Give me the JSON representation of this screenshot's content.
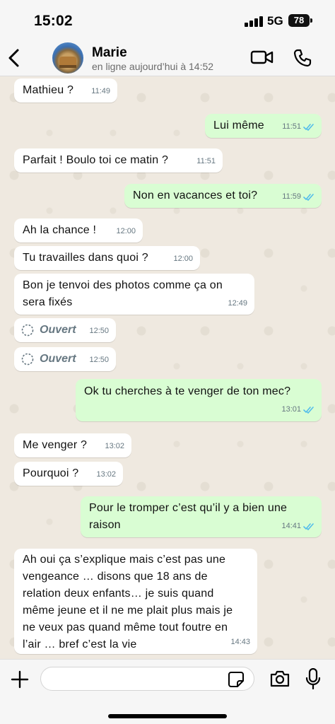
{
  "status_bar": {
    "time": "15:02",
    "network": "5G",
    "battery": "78"
  },
  "header": {
    "contact_name": "Marie",
    "contact_status": "en ligne aujourd’hui à 14:52",
    "icons": {
      "back": "chevron-left-icon",
      "video": "video-camera-icon",
      "call": "phone-icon"
    }
  },
  "messages": [
    {
      "direction": "in",
      "text": "Mathieu ?",
      "time": "11:49"
    },
    {
      "direction": "out",
      "text": "Lui même",
      "time": "11:51",
      "read": true
    },
    {
      "direction": "in",
      "text": "Parfait ! Boulo toi ce matin ?",
      "time": "11:51"
    },
    {
      "direction": "out",
      "text": "Non en vacances et toi?",
      "time": "11:59",
      "read": true
    },
    {
      "direction": "in",
      "text": "Ah la chance !",
      "time": "12:00"
    },
    {
      "direction": "in",
      "text": "Tu travailles dans quoi ?",
      "time": "12:00"
    },
    {
      "direction": "in",
      "text": "Bon je tenvoi des photos comme ça on sera fixés",
      "time": "12:49"
    },
    {
      "direction": "in",
      "text": "Ouvert",
      "time": "12:50",
      "view_once": true
    },
    {
      "direction": "in",
      "text": "Ouvert",
      "time": "12:50",
      "view_once": true
    },
    {
      "direction": "out",
      "text": "Ok tu cherches à te venger de ton mec?",
      "time": "13:01",
      "read": true
    },
    {
      "direction": "in",
      "text": "Me venger ?",
      "time": "13:02"
    },
    {
      "direction": "in",
      "text": "Pourquoi ?",
      "time": "13:02"
    },
    {
      "direction": "out",
      "text": "Pour le tromper c’est qu’il y a bien une raison",
      "time": "14:41",
      "read": true
    },
    {
      "direction": "in",
      "text": "Ah oui ça s’explique mais c’est pas une vengeance … disons que 18 ans de relation deux enfants… je suis quand même jeune et il ne me plait plus mais je ne veux pas quand même tout foutre en l’air … bref c’est la vie",
      "time": "14:43"
    }
  ],
  "input_bar": {
    "placeholder": ""
  },
  "colors": {
    "incoming": "#ffffff",
    "outgoing": "#d9fdd3",
    "read_ticks": "#53bdeb",
    "wallpaper": "#efe9e0"
  }
}
